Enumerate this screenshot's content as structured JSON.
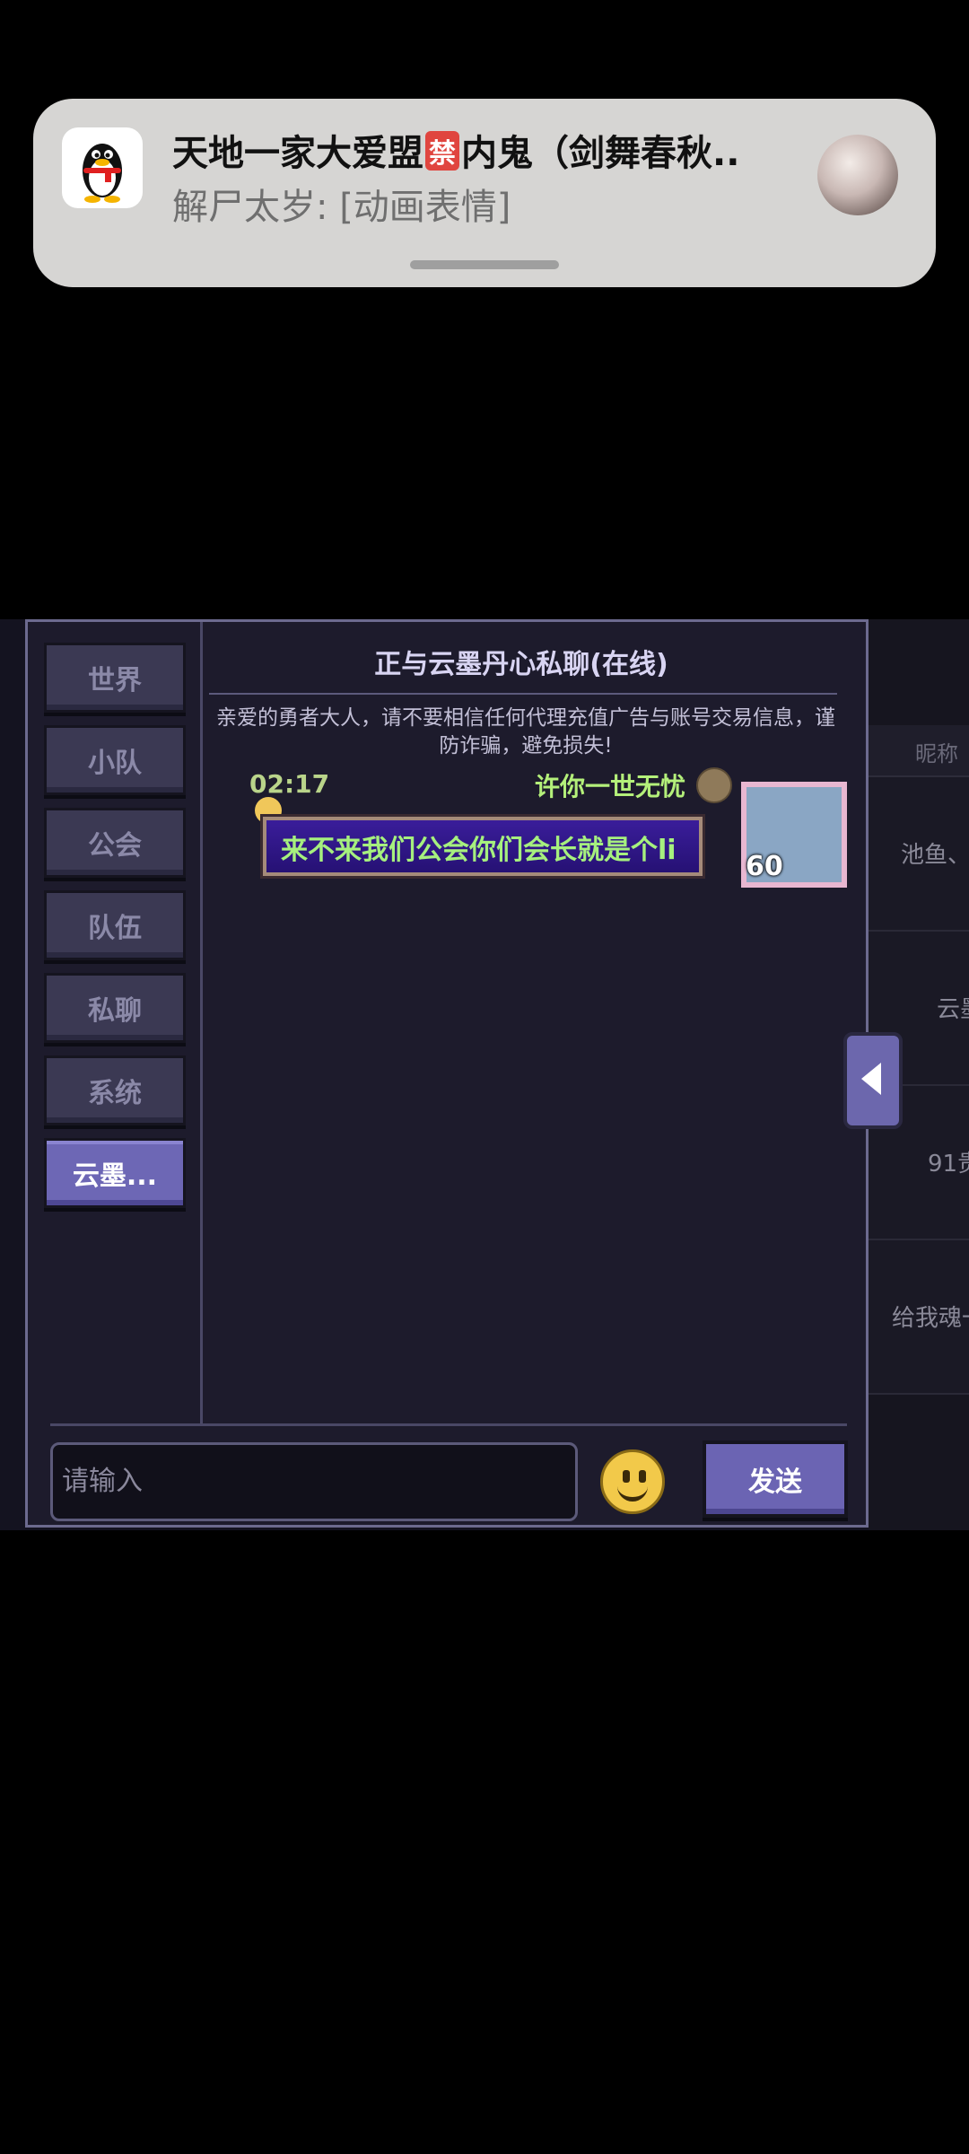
{
  "notification": {
    "title_before": "天地一家大爱盟",
    "ban_label": "禁",
    "title_after": "内鬼（剑舞春秋..",
    "body": "解尸太岁: [动画表情]",
    "app_icon": "qq-penguin-icon"
  },
  "chat": {
    "tabs": [
      {
        "label": "世界",
        "active": false
      },
      {
        "label": "小队",
        "active": false
      },
      {
        "label": "公会",
        "active": false
      },
      {
        "label": "队伍",
        "active": false
      },
      {
        "label": "私聊",
        "active": false
      },
      {
        "label": "系统",
        "active": false
      },
      {
        "label": "云墨...",
        "active": true
      }
    ],
    "title": "正与云墨丹心私聊(在线)",
    "warning": "亲爱的勇者大人，请不要相信任何代理充值广告与账号交易信息，谨防诈骗，避免损失!",
    "message": {
      "time": "02:17",
      "sender": "许你一世无忧",
      "text": "来不来我们公会你们会长就是个li",
      "level": "60"
    },
    "input_placeholder": "请输入",
    "send_label": "发送",
    "emoji_icon": "smiley-icon",
    "toggle_icon": "arrow-left-icon"
  },
  "background_list": {
    "header": "昵称",
    "rows": [
      "池鱼、",
      "云墨",
      "91贵",
      "给我魂一"
    ]
  }
}
